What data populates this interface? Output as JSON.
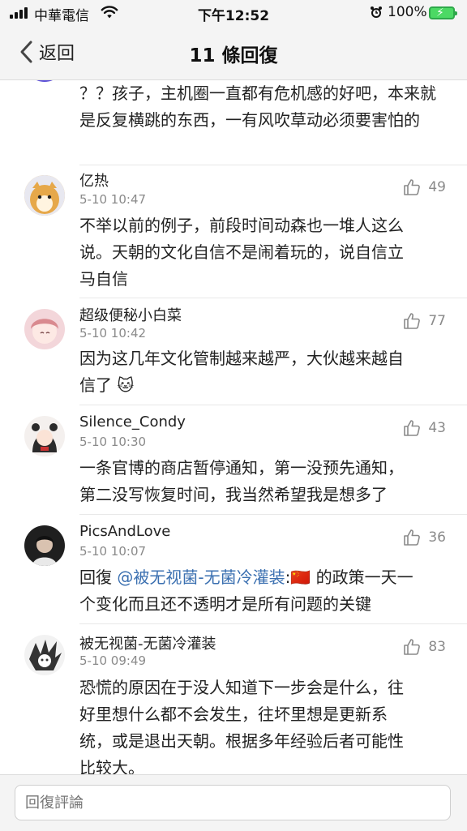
{
  "status_bar": {
    "carrier": "中華電信",
    "time": "下午12:52",
    "battery": "100%"
  },
  "nav": {
    "back_label": "返回",
    "title": "11 條回復"
  },
  "partial_comment": {
    "text": "？？孩子，主机圈一直都有危机感的好吧，本来就是反复横跳的东西，一有风吹草动必须要害怕的"
  },
  "comments": [
    {
      "name": "亿热",
      "time": "5-10 10:47",
      "likes": "49",
      "lines": [
        "不举以前的例子，前段时间动森也一堆人这么",
        "说。天朝的文化自信不是闹着玩的，说自信立",
        "马自信"
      ]
    },
    {
      "name": "超级便秘小白菜",
      "time": "5-10 10:42",
      "likes": "77",
      "lines": [
        "因为这几年文化管制越来越严，大伙越来越自",
        "信了 🐱"
      ]
    },
    {
      "name": "Silence_Condy",
      "time": "5-10 10:30",
      "likes": "43",
      "lines": [
        "一条官博的商店暂停通知，第一没预先通知，",
        "第二没写恢复时间，我当然希望我是想多了"
      ]
    },
    {
      "name": "PicsAndLove",
      "time": "5-10 10:07",
      "likes": "36",
      "reply_prefix": "回復 ",
      "mention": "@被无视菌-无菌冷灌装",
      "flag": ":🇨🇳",
      "lines": [
        " 的政策一天一",
        "个变化而且还不透明才是所有问题的关键"
      ]
    },
    {
      "name": "被无视菌-无菌冷灌装",
      "time": "5-10 09:49",
      "likes": "83",
      "lines": [
        "恐慌的原因在于没人知道下一步会是什么，往",
        "好里想什么都不会发生，往坏里想是更新系",
        "统，或是退出天朝。根据多年经验后者可能性",
        "比较大。"
      ]
    }
  ],
  "input": {
    "placeholder": "回復評論"
  }
}
